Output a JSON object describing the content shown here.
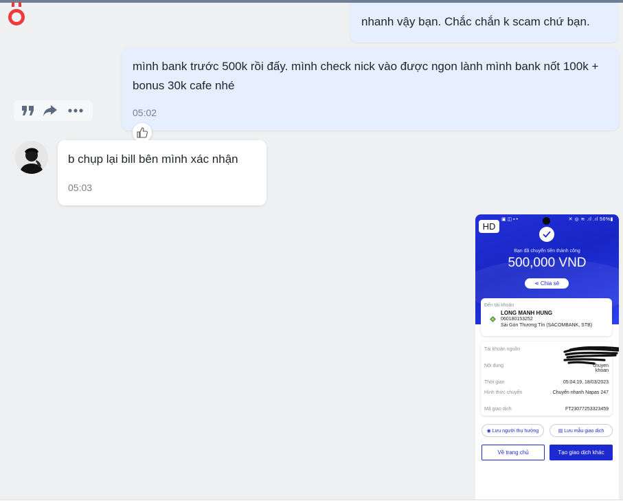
{
  "colors": {
    "accent": "#1d2ad0",
    "brand_logo": "#f03a3a",
    "outgoing_bubble": "#e5efff",
    "incoming_bubble": "#ffffff"
  },
  "messages": [
    {
      "direction": "out",
      "text": "nhanh vậy bạn. Chắc chắn k scam chứ bạn."
    },
    {
      "direction": "out",
      "text": "mình bank trước 500k rồi đấy. mình check nick vào được ngon lành mình bank nốt 100k + bonus 30k cafe nhé",
      "time": "05:02"
    },
    {
      "direction": "in",
      "text": "b chụp lại bill bên mình xác nhận",
      "time": "05:03"
    }
  ],
  "message_actions": [
    "quote-icon",
    "forward-icon",
    "more-icon"
  ],
  "reaction": {
    "icon": "thumbs-up-icon"
  },
  "receipt": {
    "badge": "HD",
    "status_bar": {
      "left": "▣ ◫ ▪ •",
      "right": "✕ ◎ ≋ .ıl .ıl 56%▮"
    },
    "success_text": "Bạn đã chuyển tiền thành công",
    "amount": "500,000 VND",
    "share_label": "Chia sẻ",
    "to_label": "Đến tài khoản",
    "recipient_name": "LONG MANH HUNG",
    "recipient_account": "060180153252",
    "recipient_bank": "Sài Gòn Thương Tín (SACOMBANK, STB)",
    "rows": [
      {
        "label": "Tài khoản nguồn",
        "value": ""
      },
      {
        "label": "Nội dung",
        "value": "chuyen khoan"
      },
      {
        "label": "Thời gian",
        "value": "05:04:19, 18/03/2023"
      },
      {
        "label": "Hình thức chuyển",
        "value": "Chuyển nhanh Napas 247"
      },
      {
        "label": "Mã giao dịch",
        "value": "FT23077253323459"
      }
    ],
    "save_beneficiary": "Lưu người thụ hưởng",
    "save_template": "Lưu mẫu giao dịch",
    "home_button": "Về trang chủ",
    "new_transaction_button": "Tạo giao dịch khác"
  }
}
